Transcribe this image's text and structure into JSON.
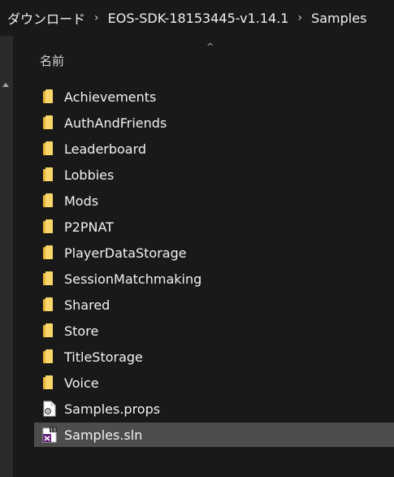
{
  "breadcrumb": {
    "items": [
      "ダウンロード",
      "EOS-SDK-18153445-v1.14.1",
      "Samples"
    ],
    "separator": "›"
  },
  "header": {
    "name_column": "名前",
    "sort_indicator": "^"
  },
  "files": [
    {
      "name": "Achievements",
      "icon": "folder-icon"
    },
    {
      "name": "AuthAndFriends",
      "icon": "folder-icon"
    },
    {
      "name": "Leaderboard",
      "icon": "folder-icon"
    },
    {
      "name": "Lobbies",
      "icon": "folder-icon"
    },
    {
      "name": "Mods",
      "icon": "folder-icon"
    },
    {
      "name": "P2PNAT",
      "icon": "folder-icon"
    },
    {
      "name": "PlayerDataStorage",
      "icon": "folder-icon"
    },
    {
      "name": "SessionMatchmaking",
      "icon": "folder-icon"
    },
    {
      "name": "Shared",
      "icon": "folder-icon"
    },
    {
      "name": "Store",
      "icon": "folder-icon"
    },
    {
      "name": "TitleStorage",
      "icon": "folder-icon"
    },
    {
      "name": "Voice",
      "icon": "folder-icon"
    },
    {
      "name": "Samples.props",
      "icon": "props-file-icon"
    },
    {
      "name": "Samples.sln",
      "icon": "visual-studio-solution-icon",
      "selected": true,
      "badge": "15"
    }
  ],
  "colors": {
    "background": "#191919",
    "selection": "#4d4d4d",
    "folder": "#f8d66a",
    "vs_purple": "#68217a"
  }
}
